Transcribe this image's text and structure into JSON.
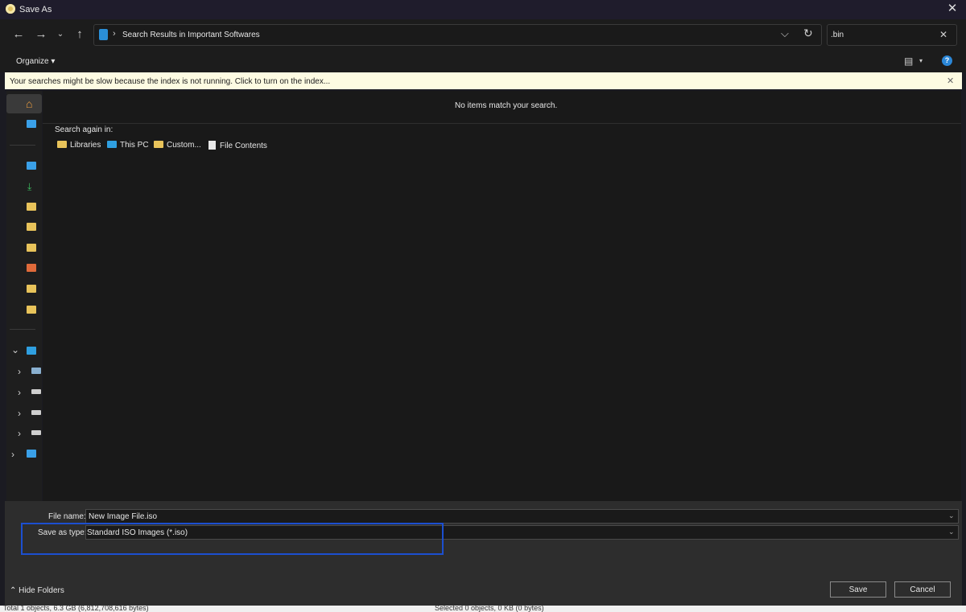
{
  "window": {
    "title": "Save As"
  },
  "nav": {
    "address": "Search Results in Important Softwares",
    "search_value": ".bin"
  },
  "toolbar": {
    "organize": "Organize ▾"
  },
  "infobar": {
    "text": "Your searches might be slow because the index is not running.  Click to turn on the index..."
  },
  "main": {
    "empty_message": "No items match your search.",
    "search_again_label": "Search again in:",
    "search_again_items": [
      "Libraries",
      "This PC",
      "Custom...",
      "File Contents"
    ]
  },
  "form": {
    "filename_label": "File name:",
    "filename_value": "New Image File.iso",
    "type_label": "Save as type:",
    "type_value": "Standard ISO Images (*.iso)"
  },
  "footer": {
    "hide_folders": "Hide Folders",
    "save_label": "Save",
    "cancel_label": "Cancel"
  },
  "statusbar": {
    "left": "Total 1 objects, 6.3 GB (6,812,708,616 bytes)",
    "right": "Selected 0 objects, 0 KB (0 bytes)"
  },
  "colors": {
    "accent": "#1c4fd0",
    "info_bg": "#fdfbe2",
    "folder": "#e8c35a"
  },
  "icons": [
    "app-icon",
    "back-arrow-icon",
    "forward-arrow-icon",
    "recent-dropdown-icon",
    "up-arrow-icon",
    "refresh-icon",
    "help-icon",
    "view-options-icon",
    "folder-icon",
    "pc-icon"
  ]
}
